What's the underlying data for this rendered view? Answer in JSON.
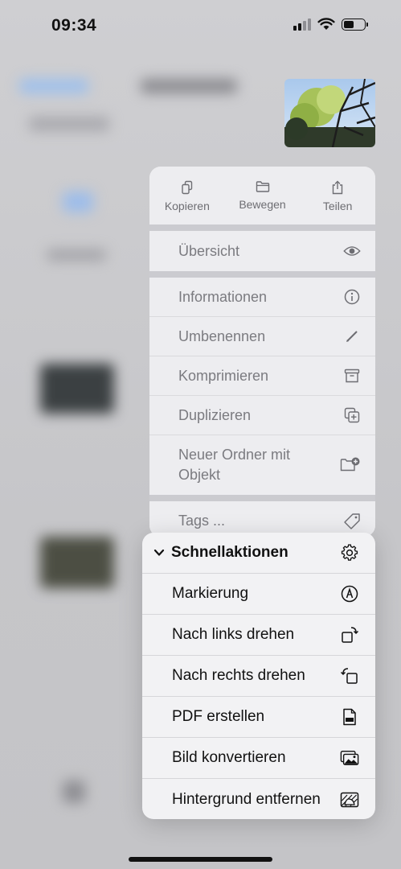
{
  "status": {
    "time": "09:34"
  },
  "actions": [
    {
      "label": "Kopieren",
      "icon": "copy-icon"
    },
    {
      "label": "Bewegen",
      "icon": "folder-icon"
    },
    {
      "label": "Teilen",
      "icon": "share-icon"
    }
  ],
  "menu": {
    "overview": "Übersicht",
    "items": [
      "Informationen",
      "Umbenennen",
      "Komprimieren",
      "Duplizieren",
      "Neuer Ordner mit Objekt"
    ],
    "tags": "Tags ..."
  },
  "quick_actions": {
    "title": "Schnellaktionen",
    "items": [
      "Markierung",
      "Nach links drehen",
      "Nach rechts drehen",
      "PDF erstellen",
      "Bild konvertieren",
      "Hintergrund entfernen"
    ]
  }
}
